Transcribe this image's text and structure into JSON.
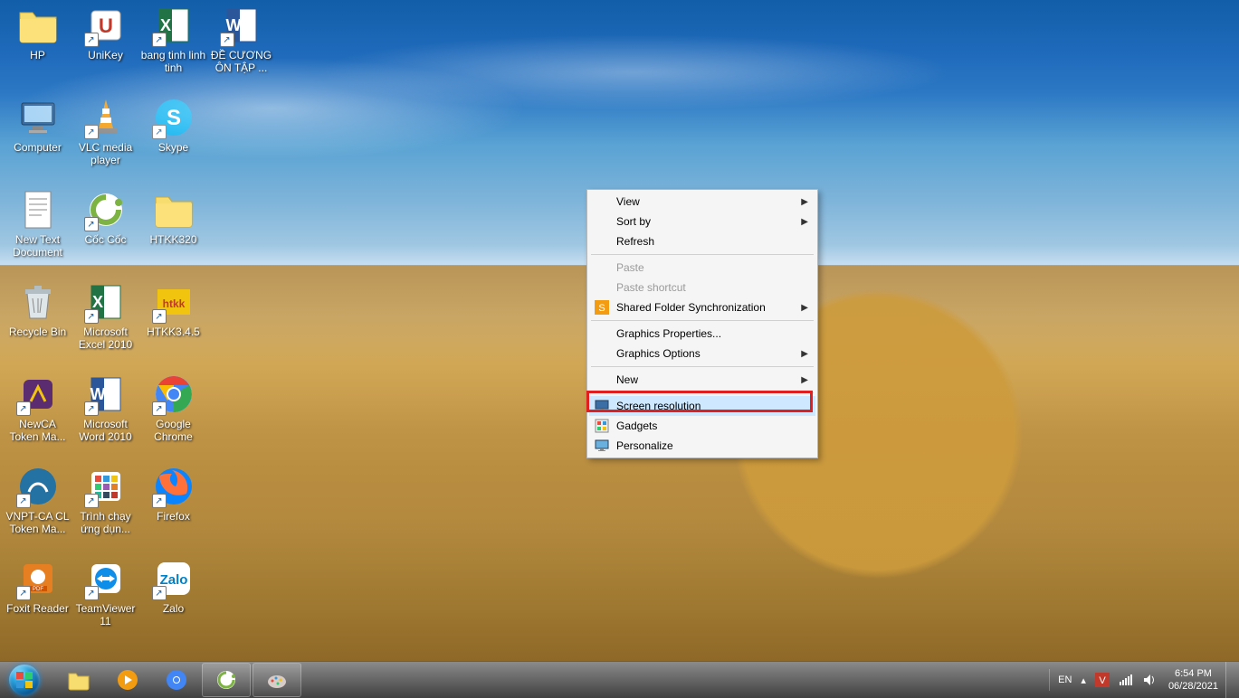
{
  "desktop_icons": [
    {
      "id": "hp",
      "label": "HP",
      "type": "folder",
      "shortcut": false
    },
    {
      "id": "unikey",
      "label": "UniKey",
      "type": "app",
      "color": "#d9534f",
      "shortcut": true,
      "glyph": "U"
    },
    {
      "id": "bangtinh",
      "label": "bang tinh linh tinh",
      "type": "excel",
      "shortcut": true
    },
    {
      "id": "decuong",
      "label": "ĐỀ CƯƠNG ÔN TẬP ...",
      "type": "word",
      "shortcut": true
    },
    {
      "id": "computer",
      "label": "Computer",
      "type": "computer",
      "shortcut": false
    },
    {
      "id": "vlc",
      "label": "VLC media player",
      "type": "vlc",
      "shortcut": true
    },
    {
      "id": "skype",
      "label": "Skype",
      "type": "skype",
      "shortcut": true
    },
    {
      "id": "blank1",
      "label": "",
      "type": "blank"
    },
    {
      "id": "newtext",
      "label": "New Text Document",
      "type": "text",
      "shortcut": false
    },
    {
      "id": "coccoc",
      "label": "Cốc Cốc",
      "type": "coccoc",
      "shortcut": true
    },
    {
      "id": "htkk320",
      "label": "HTKK320",
      "type": "folder",
      "shortcut": false
    },
    {
      "id": "blank2",
      "label": "",
      "type": "blank"
    },
    {
      "id": "recycle",
      "label": "Recycle Bin",
      "type": "recycle",
      "shortcut": false
    },
    {
      "id": "excel2010",
      "label": "Microsoft Excel 2010",
      "type": "excel-app",
      "shortcut": true
    },
    {
      "id": "htkk345",
      "label": "HTKK3.4.5",
      "type": "htkk",
      "shortcut": true
    },
    {
      "id": "blank3",
      "label": "",
      "type": "blank"
    },
    {
      "id": "newca",
      "label": "NewCA Token Ma...",
      "type": "newca",
      "shortcut": true
    },
    {
      "id": "word2010",
      "label": "Microsoft Word 2010",
      "type": "word-app",
      "shortcut": true
    },
    {
      "id": "chrome",
      "label": "Google Chrome",
      "type": "chrome",
      "shortcut": true
    },
    {
      "id": "blank4",
      "label": "",
      "type": "blank"
    },
    {
      "id": "vnptca",
      "label": "VNPT-CA CL Token Ma...",
      "type": "vnpt",
      "shortcut": true
    },
    {
      "id": "trinhchay",
      "label": "Trình chạy ứng dụn...",
      "type": "apps",
      "shortcut": true
    },
    {
      "id": "firefox",
      "label": "Firefox",
      "type": "firefox",
      "shortcut": true
    },
    {
      "id": "blank5",
      "label": "",
      "type": "blank"
    },
    {
      "id": "foxit",
      "label": "Foxit Reader",
      "type": "foxit",
      "shortcut": true
    },
    {
      "id": "teamviewer",
      "label": "TeamViewer 11",
      "type": "teamviewer",
      "shortcut": true
    },
    {
      "id": "zalo",
      "label": "Zalo",
      "type": "zalo",
      "shortcut": true
    }
  ],
  "context_menu": {
    "items": [
      {
        "label": "View",
        "enabled": true,
        "submenu": true,
        "sep_after": false
      },
      {
        "label": "Sort by",
        "enabled": true,
        "submenu": true,
        "sep_after": false
      },
      {
        "label": "Refresh",
        "enabled": true,
        "submenu": false,
        "sep_after": true
      },
      {
        "label": "Paste",
        "enabled": false,
        "submenu": false,
        "sep_after": false
      },
      {
        "label": "Paste shortcut",
        "enabled": false,
        "submenu": false,
        "sep_after": false
      },
      {
        "label": "Shared Folder Synchronization",
        "enabled": true,
        "submenu": true,
        "icon": "sync",
        "sep_after": true
      },
      {
        "label": "Graphics Properties...",
        "enabled": true,
        "submenu": false,
        "sep_after": false
      },
      {
        "label": "Graphics Options",
        "enabled": true,
        "submenu": true,
        "sep_after": true
      },
      {
        "label": "New",
        "enabled": true,
        "submenu": true,
        "sep_after": true
      },
      {
        "label": "Screen resolution",
        "enabled": true,
        "submenu": false,
        "icon": "monitor",
        "highlighted": true,
        "sep_after": false
      },
      {
        "label": "Gadgets",
        "enabled": true,
        "submenu": false,
        "icon": "gadget",
        "sep_after": false
      },
      {
        "label": "Personalize",
        "enabled": true,
        "submenu": false,
        "icon": "personalize",
        "sep_after": false
      }
    ]
  },
  "taskbar": {
    "pinned": [
      {
        "id": "explorer",
        "name": "file-explorer",
        "color": "#f4c96a"
      },
      {
        "id": "wmp",
        "name": "media-player",
        "color": "#f39c12"
      },
      {
        "id": "chrome",
        "name": "chrome",
        "color": "#ffffff"
      },
      {
        "id": "coccoc",
        "name": "coccoc",
        "running": true,
        "color": "#7cb342"
      },
      {
        "id": "paint",
        "name": "paint",
        "running": true,
        "color": "#bfa78a"
      }
    ],
    "tray": {
      "lang": "EN",
      "icons": [
        "expand",
        "app-v",
        "network",
        "volume"
      ],
      "time": "6:54 PM",
      "date": "06/28/2021"
    }
  }
}
